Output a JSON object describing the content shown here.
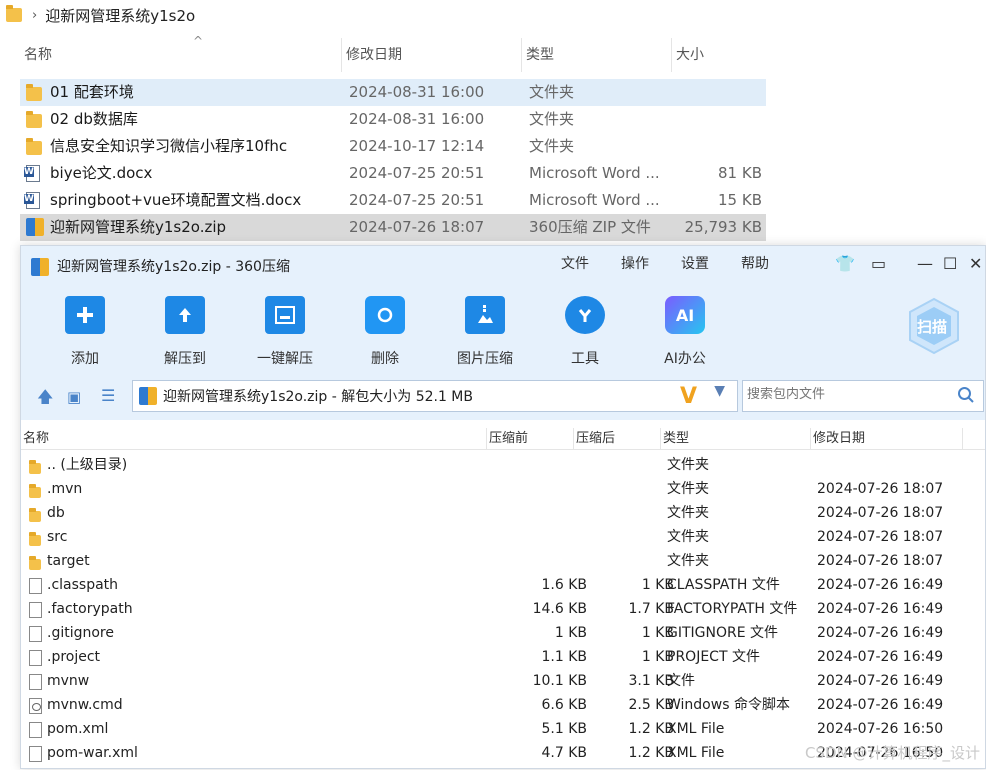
{
  "explorer": {
    "breadcrumb": "迎新网管理系统y1s2o",
    "columns": {
      "name": "名称",
      "modified": "修改日期",
      "type": "类型",
      "size": "大小"
    },
    "rows": [
      {
        "name": "01 配套环境",
        "date": "2024-08-31 16:00",
        "type": "文件夹",
        "size": "",
        "icon": "folder-icon"
      },
      {
        "name": "02 db数据库",
        "date": "2024-08-31 16:00",
        "type": "文件夹",
        "size": "",
        "icon": "folder-icon"
      },
      {
        "name": "信息安全知识学习微信小程序10fhc",
        "date": "2024-10-17 12:14",
        "type": "文件夹",
        "size": "",
        "icon": "folder-icon"
      },
      {
        "name": "biye论文.docx",
        "date": "2024-07-25 20:51",
        "type": "Microsoft Word ...",
        "size": "81 KB",
        "icon": "word-doc-icon"
      },
      {
        "name": "springboot+vue环境配置文档.docx",
        "date": "2024-07-25 20:51",
        "type": "Microsoft Word ...",
        "size": "15 KB",
        "icon": "word-doc-icon"
      },
      {
        "name": "迎新网管理系统y1s2o.zip",
        "date": "2024-07-26 18:07",
        "type": "360压缩 ZIP 文件",
        "size": "25,793 KB",
        "icon": "zip-icon"
      }
    ]
  },
  "archive": {
    "title": "迎新网管理系统y1s2o.zip - 360压缩",
    "menu": [
      "文件",
      "操作",
      "设置",
      "帮助"
    ],
    "tools": [
      {
        "label": "添加",
        "icon": "add-icon"
      },
      {
        "label": "解压到",
        "icon": "extract-to-icon"
      },
      {
        "label": "一键解压",
        "icon": "one-click-extract-icon"
      },
      {
        "label": "删除",
        "icon": "delete-icon"
      },
      {
        "label": "图片压缩",
        "icon": "image-compress-icon"
      },
      {
        "label": "工具",
        "icon": "tools-icon"
      },
      {
        "label": "AI办公",
        "icon": "ai-office-icon"
      }
    ],
    "scan_label": "扫描",
    "path_text": "迎新网管理系统y1s2o.zip - 解包大小为 52.1 MB",
    "search_placeholder": "搜索包内文件",
    "columns": {
      "name": "名称",
      "before": "压缩前",
      "after": "压缩后",
      "type": "类型",
      "modified": "修改日期"
    },
    "rows": [
      {
        "name": ".. (上级目录)",
        "before": "",
        "after": "",
        "type": "文件夹",
        "date": "",
        "icon": "folder-icon"
      },
      {
        "name": ".mvn",
        "before": "",
        "after": "",
        "type": "文件夹",
        "date": "2024-07-26 18:07",
        "icon": "folder-icon"
      },
      {
        "name": "db",
        "before": "",
        "after": "",
        "type": "文件夹",
        "date": "2024-07-26 18:07",
        "icon": "folder-icon"
      },
      {
        "name": "src",
        "before": "",
        "after": "",
        "type": "文件夹",
        "date": "2024-07-26 18:07",
        "icon": "folder-icon"
      },
      {
        "name": "target",
        "before": "",
        "after": "",
        "type": "文件夹",
        "date": "2024-07-26 18:07",
        "icon": "folder-icon"
      },
      {
        "name": ".classpath",
        "before": "1.6 KB",
        "after": "1 KB",
        "type": "CLASSPATH 文件",
        "date": "2024-07-26 16:49",
        "icon": "file-icon"
      },
      {
        "name": ".factorypath",
        "before": "14.6 KB",
        "after": "1.7 KB",
        "type": "FACTORYPATH 文件",
        "date": "2024-07-26 16:49",
        "icon": "file-icon"
      },
      {
        "name": ".gitignore",
        "before": "1 KB",
        "after": "1 KB",
        "type": "GITIGNORE 文件",
        "date": "2024-07-26 16:49",
        "icon": "file-icon"
      },
      {
        "name": ".project",
        "before": "1.1 KB",
        "after": "1 KB",
        "type": "PROJECT 文件",
        "date": "2024-07-26 16:49",
        "icon": "file-icon"
      },
      {
        "name": "mvnw",
        "before": "10.1 KB",
        "after": "3.1 KB",
        "type": "文件",
        "date": "2024-07-26 16:49",
        "icon": "file-icon"
      },
      {
        "name": "mvnw.cmd",
        "before": "6.6 KB",
        "after": "2.5 KB",
        "type": "Windows 命令脚本",
        "date": "2024-07-26 16:49",
        "icon": "cmd-file-icon"
      },
      {
        "name": "pom.xml",
        "before": "5.1 KB",
        "after": "1.2 KB",
        "type": "XML File",
        "date": "2024-07-26 16:50",
        "icon": "file-icon"
      },
      {
        "name": "pom-war.xml",
        "before": "4.7 KB",
        "after": "1.2 KB",
        "type": "XML File",
        "date": "2024-07-26 16:50",
        "icon": "file-icon"
      }
    ]
  },
  "watermark": "CSDN @计算机程序_设计",
  "colors": {
    "accent": "#1e88e5",
    "toolbar_bg": "#e6f1fc",
    "selection": "#e0edf9",
    "folder": "#f4c14a"
  }
}
